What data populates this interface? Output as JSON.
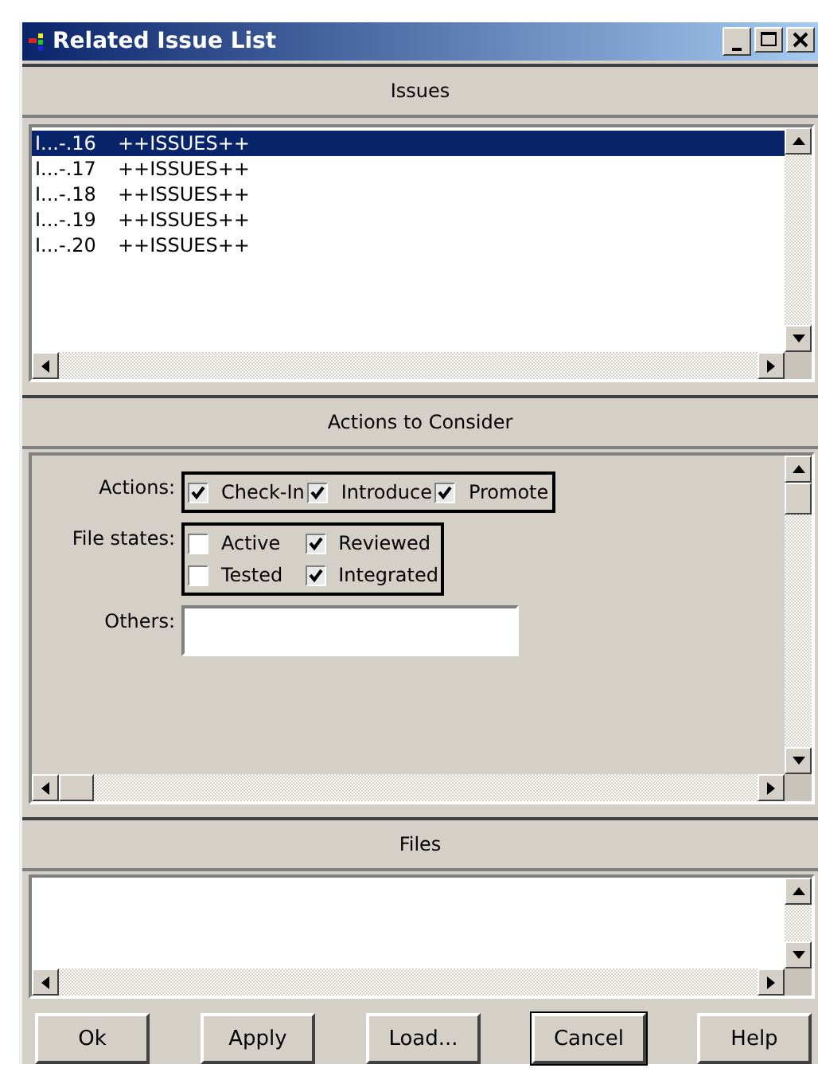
{
  "window": {
    "title": "Related Issue List"
  },
  "issues": {
    "header": "Issues",
    "rows": [
      {
        "id": "I...-.16",
        "name": "++ISSUES++",
        "selected": true
      },
      {
        "id": "I...-.17",
        "name": "++ISSUES++",
        "selected": false
      },
      {
        "id": "I...-.18",
        "name": "++ISSUES++",
        "selected": false
      },
      {
        "id": "I...-.19",
        "name": "++ISSUES++",
        "selected": false
      },
      {
        "id": "I...-.20",
        "name": "++ISSUES++",
        "selected": false
      }
    ]
  },
  "actions_panel": {
    "header": "Actions to Consider",
    "actions": {
      "label": "Actions:",
      "options": [
        {
          "label": "Check-In",
          "checked": true
        },
        {
          "label": "Introduce",
          "checked": true
        },
        {
          "label": "Promote",
          "checked": true
        }
      ]
    },
    "file_states": {
      "label": "File states:",
      "options": [
        {
          "label": "Active",
          "checked": false
        },
        {
          "label": "Reviewed",
          "checked": true
        },
        {
          "label": "Tested",
          "checked": false
        },
        {
          "label": "Integrated",
          "checked": true
        }
      ]
    },
    "others": {
      "label": "Others:"
    }
  },
  "files": {
    "header": "Files"
  },
  "buttons": [
    {
      "label": "Ok",
      "default": false
    },
    {
      "label": "Apply",
      "default": false
    },
    {
      "label": "Load...",
      "default": false
    },
    {
      "label": "Cancel",
      "default": true
    },
    {
      "label": "Help",
      "default": false
    }
  ]
}
